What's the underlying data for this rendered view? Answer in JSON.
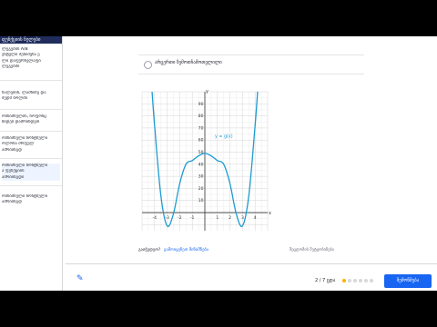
{
  "sidebar": {
    "title": "ფუნქციის ნულები",
    "items": [
      {
        "lines": [
          "ლეგების A/B",
          "ენტული შენიშვნა ე",
          "ლი დაფურჩვლაფი",
          "ლეგებში"
        ]
      },
      {
        "lines": [
          "ნალებიხ, ლამნიზე და",
          "შედმ ბოლმი"
        ]
      },
      {
        "lines": [
          "ოსნიშნულის, ჩოფონც",
          "ზიდებ დამრინდვთ"
        ]
      },
      {
        "lines": [
          "ოსნიშნული ზონტნული",
          "ოლონა მრფულ",
          "ამრიინგდ"
        ]
      },
      {
        "lines": [
          "ოსნიშნული ზონტნული",
          "ა ფუნქციის",
          "ამრიინგდი"
        ]
      },
      {
        "lines": [
          "ოსნიშნული ზონტნული",
          "ამრიინგდ"
        ]
      }
    ]
  },
  "hint": {
    "text": "არცერთი ზემოთჩამოთვლილი"
  },
  "chart_data": {
    "type": "line",
    "function_label": "y = g(x)",
    "x_ticks": [
      "-4",
      "-3",
      "-2",
      "-1",
      "1",
      "2",
      "3",
      "4"
    ],
    "y_ticks": [
      "10",
      "20",
      "30",
      "40",
      "50",
      "60",
      "70",
      "80",
      "90"
    ],
    "x_axis_label": "x",
    "y_axis_label": "y",
    "xlim": [
      -5,
      5
    ],
    "ylim": [
      -15,
      100
    ],
    "grid": true,
    "x": [
      -4.2,
      -4,
      -3.5,
      -3,
      -2.5,
      -2,
      -1.5,
      -1,
      -0.5,
      0,
      0.5,
      1,
      1.5,
      2,
      2.5,
      3,
      3.5,
      4,
      4.2
    ],
    "y": [
      100,
      72,
      14,
      -11,
      -1,
      24,
      40,
      43,
      47,
      49,
      47,
      43,
      40,
      24,
      -1,
      -11,
      14,
      72,
      100
    ],
    "color": "#1c9bd1"
  },
  "footer": {
    "stuck_label": "გაიჭედეთ?",
    "stuck_link": "გამოიყენეთ მინიშნება",
    "report": "შეცდომის შეტყობინება",
    "progress": "2 / 7 ცდა",
    "check_button": "შემოწმება"
  },
  "colors": {
    "accent": "#1865f2",
    "dot_done": "#ffb100",
    "dot_empty": "#d6d8da"
  }
}
